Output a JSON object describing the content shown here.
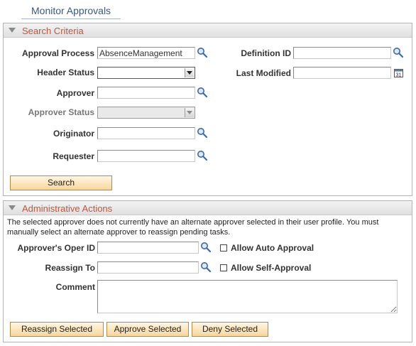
{
  "page": {
    "title": "Monitor Approvals"
  },
  "search_criteria": {
    "title": "Search Criteria",
    "approval_process": {
      "label": "Approval Process",
      "value": "AbsenceManagement"
    },
    "definition_id": {
      "label": "Definition ID",
      "value": ""
    },
    "header_status": {
      "label": "Header Status",
      "value": ""
    },
    "last_modified": {
      "label": "Last Modified",
      "value": ""
    },
    "approver": {
      "label": "Approver",
      "value": ""
    },
    "approver_status": {
      "label": "Approver Status",
      "value": ""
    },
    "originator": {
      "label": "Originator",
      "value": ""
    },
    "requester": {
      "label": "Requester",
      "value": ""
    },
    "search_button": "Search"
  },
  "admin_actions": {
    "title": "Administrative Actions",
    "message": "The selected approver does not currently have an alternate approver selected in their user profile.  You must manually select an alternate approver to reassign pending tasks.",
    "approvers_oper_id": {
      "label": "Approver's Oper ID",
      "value": ""
    },
    "reassign_to": {
      "label": "Reassign To",
      "value": ""
    },
    "allow_auto_approval": {
      "label": "Allow Auto Approval",
      "checked": false
    },
    "allow_self_approval": {
      "label": "Allow Self-Approval",
      "checked": false
    },
    "comment": {
      "label": "Comment",
      "value": ""
    },
    "buttons": {
      "reassign": "Reassign Selected",
      "approve": "Approve Selected",
      "deny": "Deny Selected"
    }
  },
  "icons": {
    "lookup": "magnifier-icon",
    "calendar": "calendar-icon",
    "collapse": "triangle-down-icon"
  },
  "colors": {
    "title": "#36598a",
    "section_title": "#c0573c",
    "button_fill": "#f8d69a",
    "button_border": "#b88a3c"
  }
}
